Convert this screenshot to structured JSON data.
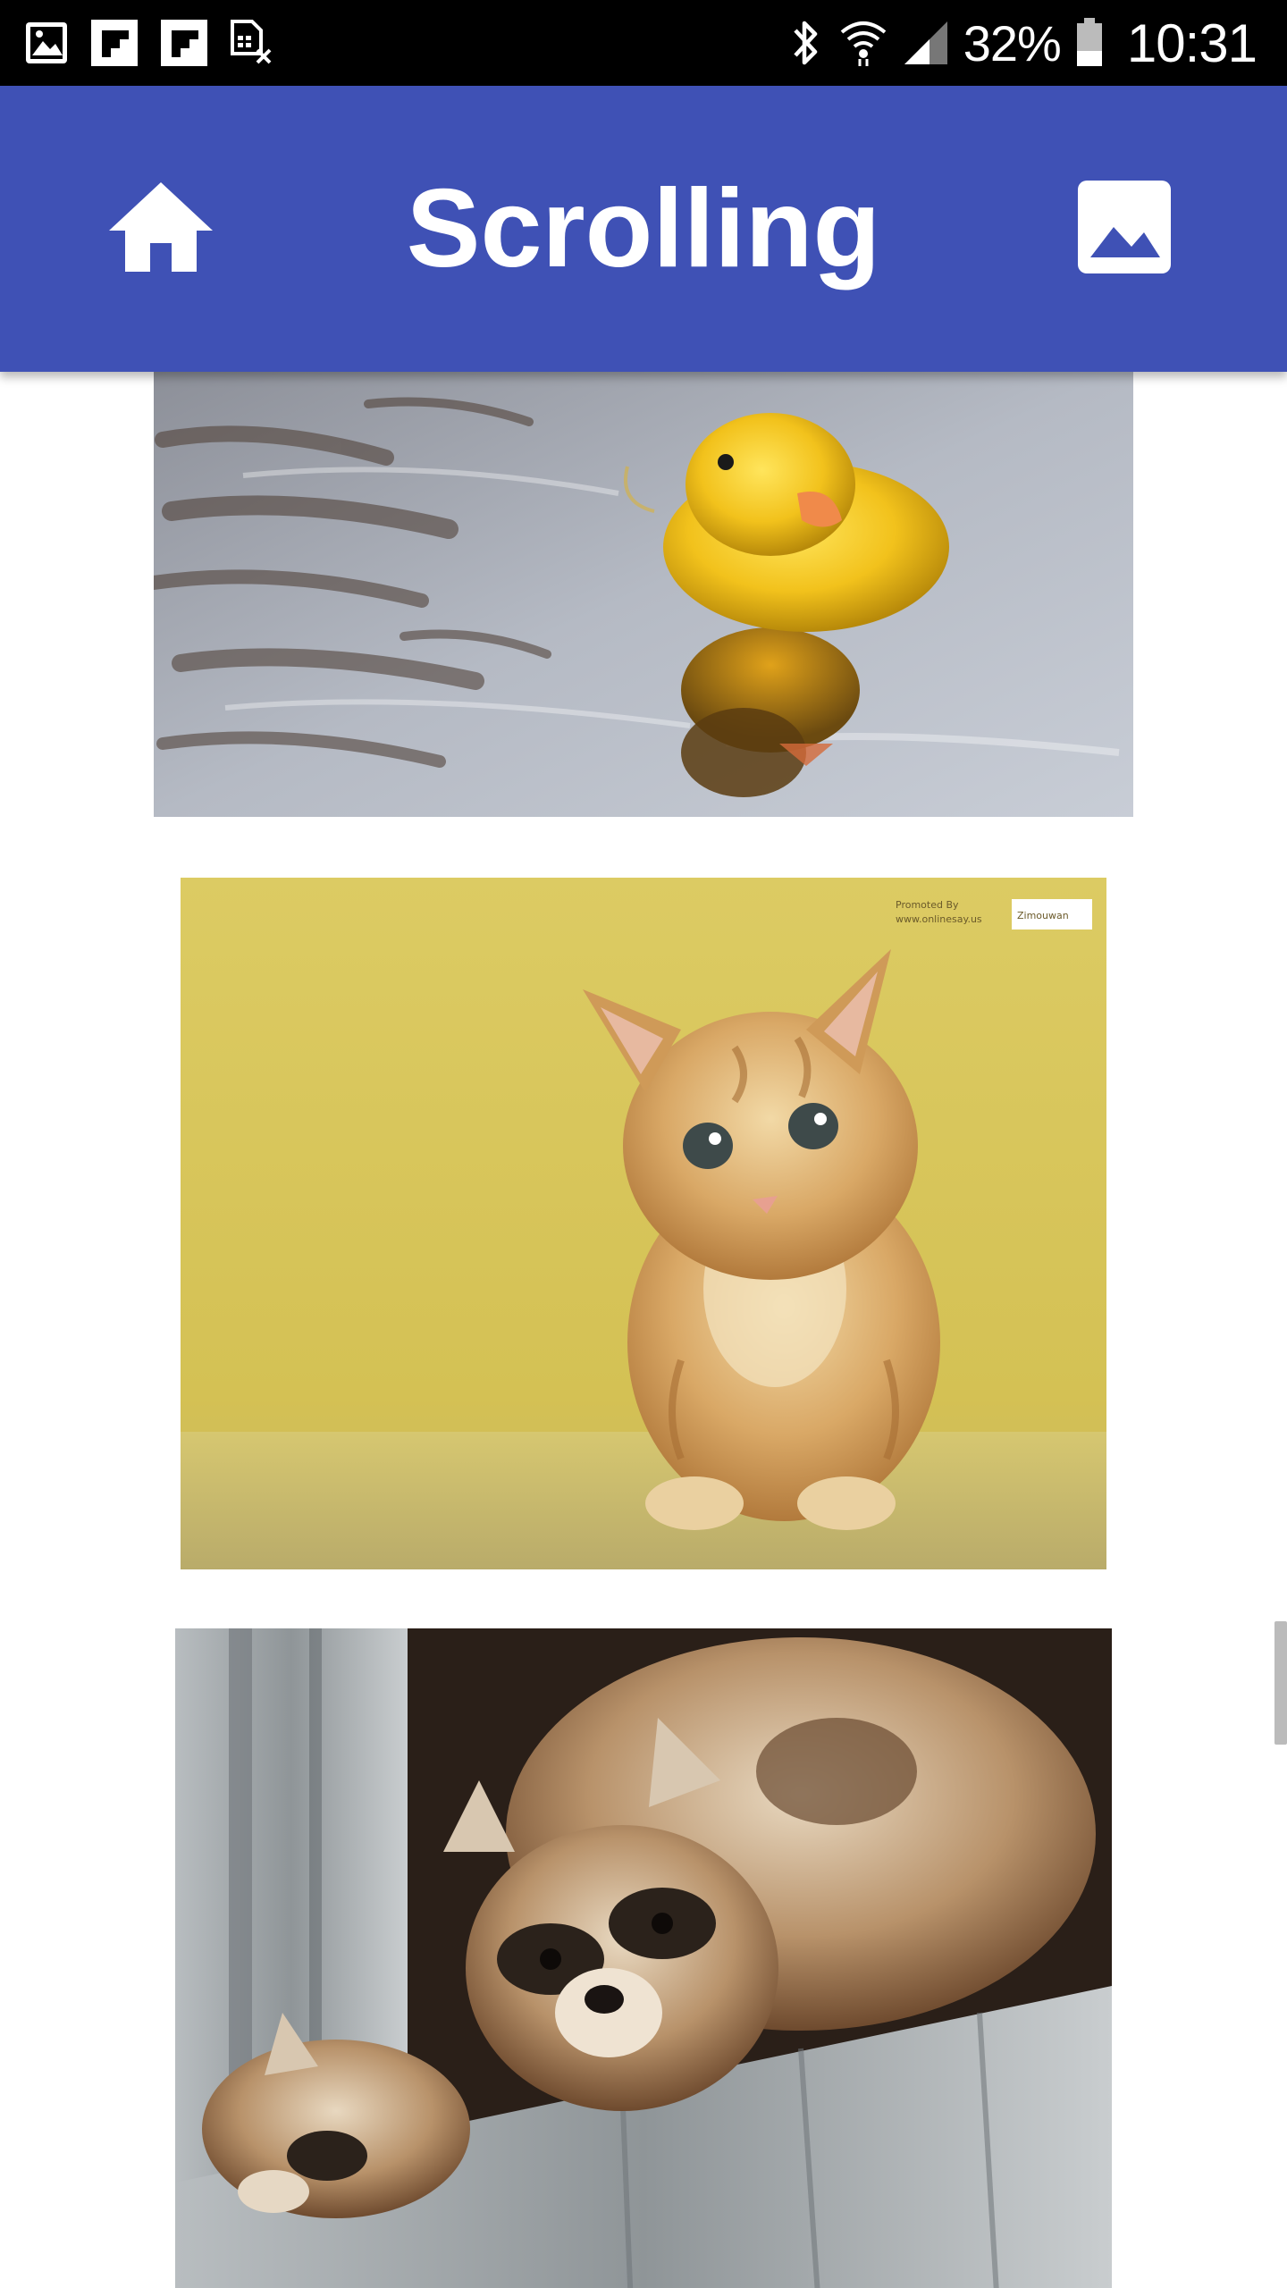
{
  "status_bar": {
    "notification_icons": [
      "gallery-icon",
      "flipboard-icon",
      "flipboard-icon",
      "sim-card-off-icon"
    ],
    "system_icons": [
      "bluetooth-icon",
      "wifi-icon",
      "cellular-signal-icon"
    ],
    "battery_percent": "32%",
    "battery_icon": "battery-icon",
    "time": "10:31"
  },
  "app_bar": {
    "title": "Scrolling",
    "background_color": "#3f51b5",
    "left_icon": "home-icon",
    "right_icon": "image-icon"
  },
  "content": {
    "photos": [
      {
        "subject": "duckling",
        "name": "duckling-photo"
      },
      {
        "subject": "kitten",
        "name": "kitten-photo",
        "watermark": [
          "Promoted By",
          "www.onlinesay.us",
          "Zimouwan"
        ]
      },
      {
        "subject": "raccoons",
        "name": "raccoons-photo"
      }
    ]
  }
}
